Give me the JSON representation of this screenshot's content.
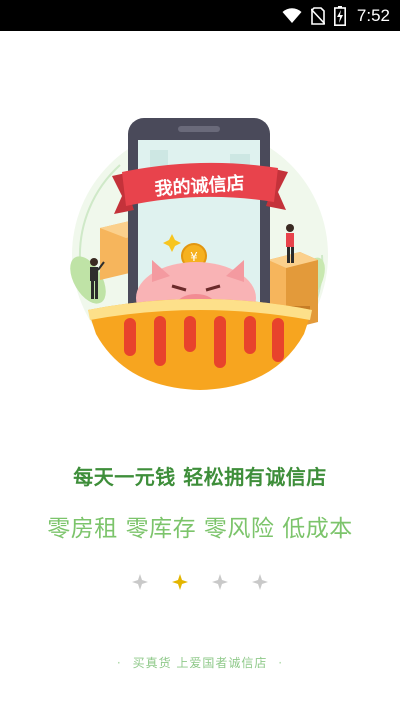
{
  "status_bar": {
    "time": "7:52",
    "icons": [
      "wifi-icon",
      "no-sim-icon",
      "battery-charging-icon"
    ]
  },
  "illustration": {
    "banner_text": "我的诚信店",
    "icons": [
      "phone-icon",
      "piggy-bank-icon",
      "coin-icon",
      "box-icon",
      "person-icon"
    ]
  },
  "slogan": {
    "headline": "每天一元钱 轻松拥有诚信店",
    "subline": "零房租 零库存 零风险 低成本"
  },
  "pager": {
    "count": 4,
    "active_index": 1,
    "colors": {
      "active": "#e3b500",
      "inactive": "#c9c9c9"
    }
  },
  "footer": {
    "text": "买真货 上爱国者诚信店",
    "dot": "·"
  },
  "colors": {
    "headline": "#3e8e3a",
    "subline": "#7cc46b",
    "accent_red": "#e8434c",
    "orange": "#f7a51f"
  }
}
